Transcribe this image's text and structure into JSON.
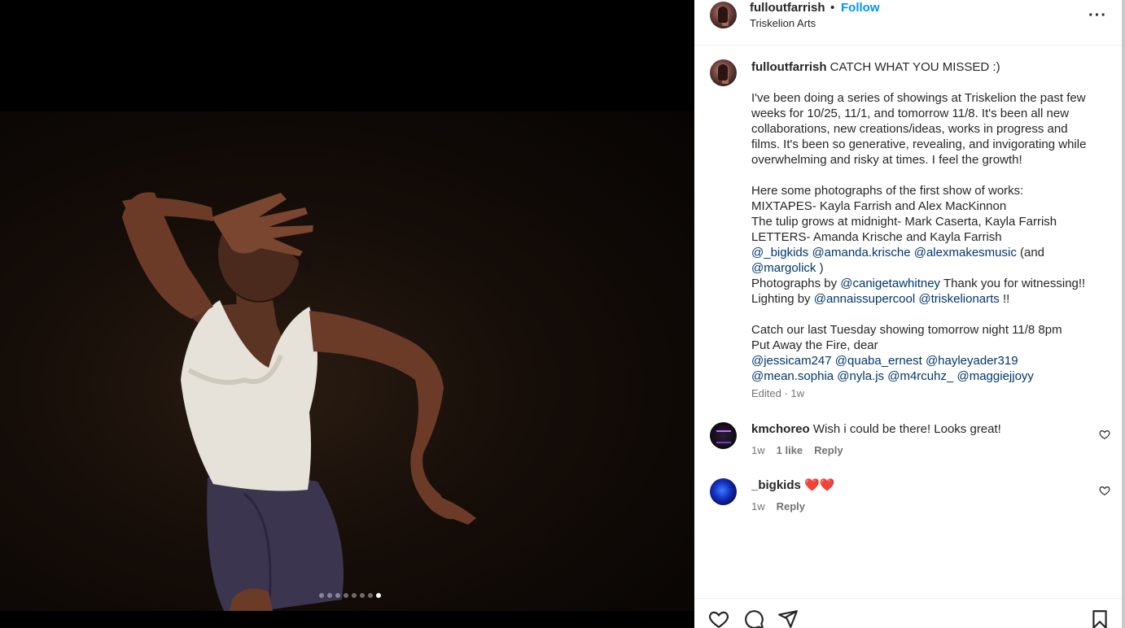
{
  "post": {
    "username": "fulloutfarrish",
    "separator": "•",
    "follow_label": "Follow",
    "location": "Triskelion Arts",
    "more_label": "···"
  },
  "media": {
    "total_slides": 8,
    "active_slide": 8
  },
  "caption": {
    "username": "fulloutfarrish",
    "headline": "CATCH WHAT YOU MISSED :)",
    "para1": [
      "I've been doing a series of showings at Triskelion the past few",
      "weeks for 10/25, 11/1, and tomorrow 11/8. It's been all new",
      "collaborations, new creations/ideas, works in progress and",
      "films. It's been so generative, revealing, and invigorating while",
      "overwhelming and risky at times. I feel the growth!"
    ],
    "para2": [
      "Here some photographs of the first show of works:",
      "MIXTAPES- Kayla Farrish and Alex MacKinnon",
      "The tulip grows at midnight- Mark Caserta, Kayla Farrish",
      "LETTERS- Amanda Krische and Kayla Farrish"
    ],
    "mentions1": [
      "@_bigkids",
      "@amanda.krische",
      "@alexmakesmusic"
    ],
    "and_open": "(and",
    "mention_margolick": "@margolick",
    "close_paren": ")",
    "photographs_by": "Photographs by",
    "photographer": "@canigetawhitney",
    "thanks": "Thank you for witnessing!!",
    "lighting_by": "Lighting by",
    "lighting_mentions": [
      "@annaissupercool",
      "@triskelionarts"
    ],
    "lighting_end": "!!",
    "para3": [
      "Catch our last Tuesday showing tomorrow night 11/8 8pm",
      "Put Away the Fire, dear"
    ],
    "mentions2": [
      "@jessicam247",
      "@quaba_ernest",
      "@hayleyader319"
    ],
    "mentions3": [
      "@mean.sophia",
      "@nyla.js",
      "@m4rcuhz_",
      "@maggiejjoyy"
    ],
    "meta": "Edited · 1w"
  },
  "comments": [
    {
      "username": "kmchoreo",
      "text": "Wish i could be there! Looks great!",
      "time": "1w",
      "likes": "1 like",
      "reply": "Reply"
    },
    {
      "username": "_bigkids",
      "text": "❤️❤️",
      "time": "1w",
      "reply": "Reply"
    }
  ],
  "colors": {
    "follow": "#0095f6",
    "mention": "#00376b",
    "secondary_text": "#737373"
  },
  "icons": [
    "heart-icon",
    "comment-icon",
    "share-icon",
    "save-icon",
    "more-icon"
  ]
}
